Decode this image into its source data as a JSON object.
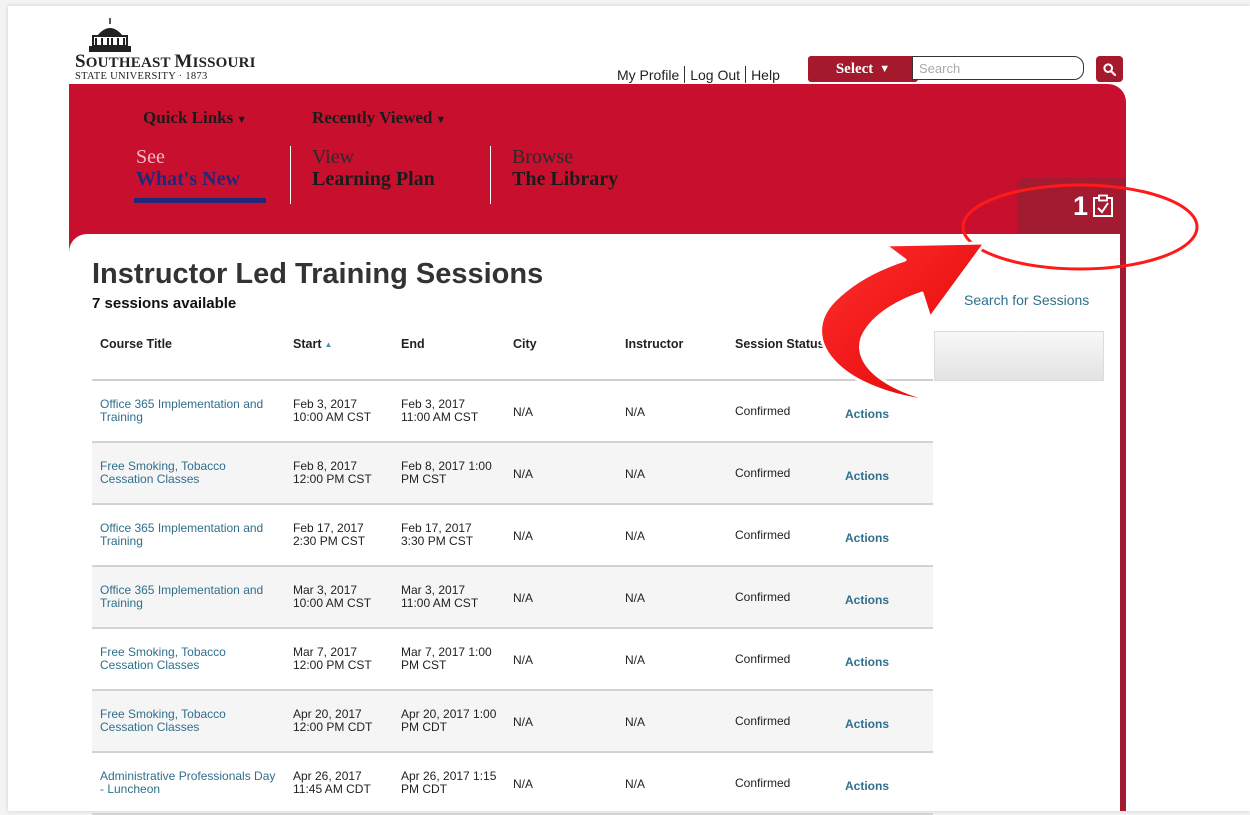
{
  "logo": {
    "line1_big": "S",
    "line1_rest": "OUTHEAST ",
    "line1_big2": "M",
    "line1_rest2": "ISSOURI",
    "line2": "STATE UNIVERSITY · 1873"
  },
  "util_nav": {
    "profile": "My Profile",
    "logout": "Log Out",
    "help": "Help"
  },
  "select_button": {
    "label": "Select",
    "caret": "▼"
  },
  "search": {
    "placeholder": "Search"
  },
  "dropdowns": {
    "quick_links": "Quick Links",
    "recently_viewed": "Recently Viewed",
    "caret": "▼"
  },
  "nav": [
    {
      "line1": "See",
      "line2": "What's New"
    },
    {
      "line1": "View",
      "line2": "Learning Plan"
    },
    {
      "line1": "Browse",
      "line2": "The Library"
    }
  ],
  "tray": {
    "count": "1"
  },
  "page": {
    "title": "Instructor Led Training Sessions",
    "subtitle": "7 sessions available",
    "search_link": "Search for Sessions"
  },
  "table": {
    "columns": [
      "Course Title",
      "Start",
      "End",
      "City",
      "Instructor",
      "Session Status"
    ],
    "rows": [
      {
        "course": "Office 365 Implementation and Training",
        "start": "Feb 3, 2017 10:00 AM CST",
        "end": "Feb 3, 2017 11:00 AM CST",
        "city": "N/A",
        "instructor": "N/A",
        "status": "Confirmed",
        "action": "Actions"
      },
      {
        "course": "Free Smoking, Tobacco Cessation Classes",
        "start": "Feb 8, 2017 12:00 PM CST",
        "end": "Feb 8, 2017 1:00 PM CST",
        "city": "N/A",
        "instructor": "N/A",
        "status": "Confirmed",
        "action": "Actions"
      },
      {
        "course": "Office 365 Implementation and Training",
        "start": "Feb 17, 2017 2:30 PM CST",
        "end": "Feb 17, 2017 3:30 PM CST",
        "city": "N/A",
        "instructor": "N/A",
        "status": "Confirmed",
        "action": "Actions"
      },
      {
        "course": "Office 365 Implementation and Training",
        "start": "Mar 3, 2017 10:00 AM CST",
        "end": "Mar 3, 2017 11:00 AM CST",
        "city": "N/A",
        "instructor": "N/A",
        "status": "Confirmed",
        "action": "Actions"
      },
      {
        "course": "Free Smoking, Tobacco Cessation Classes",
        "start": "Mar 7, 2017 12:00 PM CST",
        "end": "Mar 7, 2017 1:00 PM CST",
        "city": "N/A",
        "instructor": "N/A",
        "status": "Confirmed",
        "action": "Actions"
      },
      {
        "course": "Free Smoking, Tobacco Cessation Classes",
        "start": "Apr 20, 2017 12:00 PM CDT",
        "end": "Apr 20, 2017 1:00 PM CDT",
        "city": "N/A",
        "instructor": "N/A",
        "status": "Confirmed",
        "action": "Actions"
      },
      {
        "course": "Administrative Professionals Day - Luncheon",
        "start": "Apr 26, 2017 11:45 AM CDT",
        "end": "Apr 26, 2017 1:15 PM CDT",
        "city": "N/A",
        "instructor": "N/A",
        "status": "Confirmed",
        "action": "Actions"
      }
    ]
  },
  "colors": {
    "brand_red": "#c8102e",
    "dark_red": "#a31b31",
    "navy": "#22277a",
    "link_blue": "#2f6f8c",
    "annotation_red": "#ff1a1a"
  }
}
